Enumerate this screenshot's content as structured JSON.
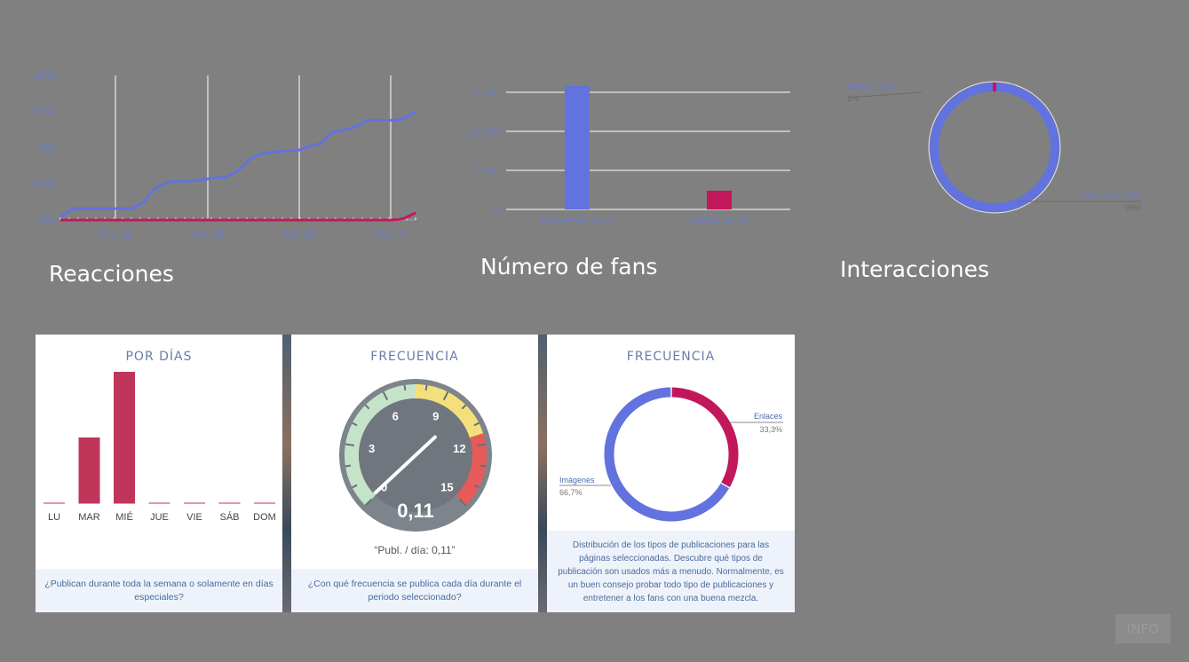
{
  "charts": {
    "reacciones": {
      "title": "Reacciones",
      "chart_data": {
        "type": "line",
        "title": "Reacciones",
        "x_ticks": [
          "feb. 11",
          "feb. 18",
          "feb. 25",
          "mar. 4"
        ],
        "x": [
          "feb. 5",
          "feb. 6",
          "feb. 7",
          "feb. 8",
          "feb. 9",
          "feb. 10",
          "feb. 11",
          "feb. 12",
          "feb. 13",
          "feb. 14",
          "feb. 15",
          "feb. 16",
          "feb. 17",
          "feb. 18",
          "feb. 19",
          "feb. 20",
          "feb. 21",
          "feb. 22",
          "feb. 23",
          "feb. 24",
          "feb. 25",
          "feb. 26",
          "feb. 27",
          "feb. 28",
          "mar. 1",
          "mar. 2",
          "mar. 3",
          "mar. 4",
          "mar. 5",
          "mar. 6"
        ],
        "y_ticks": [
          "0%",
          "2,5%",
          "5%",
          "7,5%",
          "10%"
        ],
        "ylim": [
          0,
          10
        ],
        "series": [
          {
            "color": "#6272de",
            "values": [
              0.2,
              0.8,
              0.8,
              0.8,
              0.8,
              0.8,
              0.8,
              1.2,
              2.2,
              2.6,
              2.7,
              2.7,
              2.8,
              2.9,
              3.0,
              3.4,
              4.2,
              4.6,
              4.7,
              4.8,
              4.8,
              5.1,
              5.3,
              6.1,
              6.2,
              6.5,
              6.9,
              6.9,
              6.9,
              7.0,
              7.5
            ]
          },
          {
            "color": "#c2185b",
            "values": [
              0,
              0,
              0,
              0,
              0,
              0,
              0,
              0,
              0,
              0,
              0,
              0,
              0,
              0,
              0,
              0,
              0,
              0,
              0,
              0,
              0,
              0,
              0,
              0,
              0,
              0,
              0,
              0,
              0,
              0.1,
              0.5
            ]
          }
        ]
      }
    },
    "fans": {
      "title": "Número de fans",
      "chart_data": {
        "type": "bar",
        "title": "Número de fans",
        "categories": [
          "Undressed MOD",
          "Darjeeling Mx"
        ],
        "values": [
          15800,
          2400
        ],
        "colors": [
          "#6272de",
          "#c2185b"
        ],
        "y_ticks": [
          "0",
          "5.000",
          "10.000",
          "15.000"
        ],
        "ylim": [
          0,
          15000
        ]
      }
    },
    "interacciones": {
      "title": "Interacciones",
      "chart_data": {
        "type": "pie",
        "title": "Interacciones",
        "labels": [
          "Darjeeling Mx",
          "Undressed MOD"
        ],
        "percent_labels": [
          "1%",
          "99%"
        ],
        "values": [
          1,
          99
        ],
        "colors": [
          "#c2185b",
          "#6272de"
        ]
      }
    }
  },
  "cards": {
    "por_dias": {
      "title": "POR DÍAS",
      "footer": "¿Publican durante toda la semana o solamente en días especiales?",
      "chart_data": {
        "type": "bar",
        "categories": [
          "LU",
          "MAR",
          "MIÉ",
          "JUE",
          "VIE",
          "SÁB",
          "DOM"
        ],
        "values": [
          0,
          1,
          2,
          0,
          0,
          0,
          0
        ],
        "color": "#c0365a"
      }
    },
    "frecuencia": {
      "title": "FRECUENCIA",
      "gauge_value": "0,11",
      "gauge_value_num": 0.11,
      "gauge_ticks": [
        "0",
        "3",
        "6",
        "9",
        "12",
        "15"
      ],
      "caption": "“Publ. / día: 0,11”",
      "footer": "¿Con qué frecuencia se publica cada día durante el periodo seleccionado?"
    },
    "tipos": {
      "title": "FRECUENCIA",
      "footer": "Distribución de los tipos de publicaciones para las páginas seleccionadas. Descubre qué tipos de publicación son usados más a menudo. Normalmente, es un buen consejo probar todo tipo de publicaciones y entretener a los fans con una buena mezcla.",
      "chart_data": {
        "type": "pie",
        "labels": [
          "Enlaces",
          "Imágenes"
        ],
        "percent_labels": [
          "33,3%",
          "66,7%"
        ],
        "values": [
          33.3,
          66.7
        ],
        "colors": [
          "#c2185b",
          "#6272de"
        ]
      }
    }
  },
  "info_button": "INFO"
}
